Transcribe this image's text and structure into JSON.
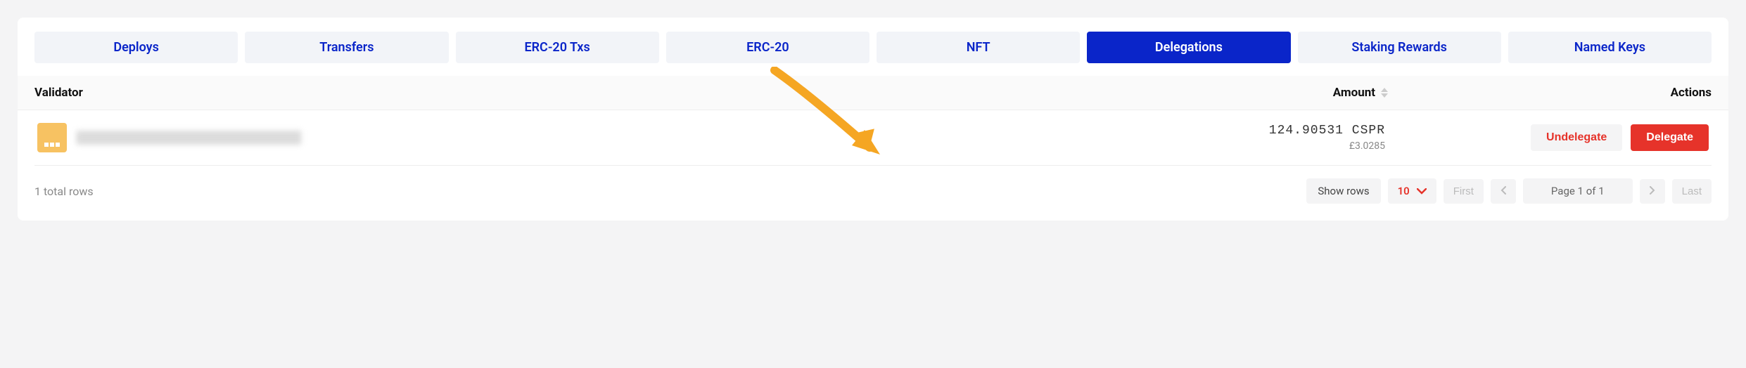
{
  "tabs": [
    {
      "label": "Deploys",
      "active": false
    },
    {
      "label": "Transfers",
      "active": false
    },
    {
      "label": "ERC-20 Txs",
      "active": false
    },
    {
      "label": "ERC-20",
      "active": false
    },
    {
      "label": "NFT",
      "active": false
    },
    {
      "label": "Delegations",
      "active": true
    },
    {
      "label": "Staking Rewards",
      "active": false
    },
    {
      "label": "Named Keys",
      "active": false
    }
  ],
  "columns": {
    "validator": "Validator",
    "amount": "Amount",
    "actions": "Actions"
  },
  "row": {
    "amount": "124.90531 CSPR",
    "fiat": "£3.0285"
  },
  "actions": {
    "undelegate": "Undelegate",
    "delegate": "Delegate"
  },
  "footer": {
    "total": "1 total rows",
    "show_rows": "Show rows",
    "rows_value": "10",
    "first": "First",
    "page_info": "Page 1 of 1",
    "last": "Last"
  }
}
